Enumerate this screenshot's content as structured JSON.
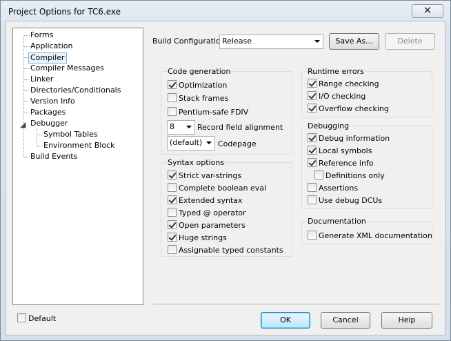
{
  "window": {
    "title": "Project Options for TC6.exe",
    "close_glyph": "✕"
  },
  "tree": {
    "items": [
      {
        "label": "Forms"
      },
      {
        "label": "Application"
      },
      {
        "label": "Compiler",
        "selected": true
      },
      {
        "label": "Compiler Messages"
      },
      {
        "label": "Linker"
      },
      {
        "label": "Directories/Conditionals"
      },
      {
        "label": "Version Info"
      },
      {
        "label": "Packages"
      },
      {
        "label": "Debugger",
        "expanded": true
      },
      {
        "label": "Symbol Tables"
      },
      {
        "label": "Environment Block"
      },
      {
        "label": "Build Events"
      }
    ],
    "expander_glyph": "◢"
  },
  "build_config": {
    "label": "Build Configuration",
    "value": "Release",
    "save_as_label": "Save As...",
    "delete_label": "Delete"
  },
  "code_generation": {
    "title": "Code generation",
    "optimization": {
      "label": "Optimization",
      "checked": true
    },
    "stack_frames": {
      "label": "Stack frames",
      "checked": false
    },
    "pentium_fdiv": {
      "label": "Pentium-safe FDIV",
      "checked": false
    },
    "record_alignment": {
      "value": "8",
      "label": "Record field alignment"
    },
    "codepage": {
      "value": "(default)",
      "label": "Codepage"
    }
  },
  "syntax_options": {
    "title": "Syntax options",
    "items": [
      {
        "label": "Strict var-strings",
        "checked": true
      },
      {
        "label": "Complete boolean eval",
        "checked": false
      },
      {
        "label": "Extended syntax",
        "checked": true
      },
      {
        "label": "Typed @ operator",
        "checked": false
      },
      {
        "label": "Open parameters",
        "checked": true
      },
      {
        "label": "Huge strings",
        "checked": true
      },
      {
        "label": "Assignable typed constants",
        "checked": false
      }
    ]
  },
  "runtime_errors": {
    "title": "Runtime errors",
    "items": [
      {
        "label": "Range checking",
        "checked": true
      },
      {
        "label": "I/O checking",
        "checked": true
      },
      {
        "label": "Overflow checking",
        "checked": true
      }
    ]
  },
  "debugging": {
    "title": "Debugging",
    "items": [
      {
        "label": "Debug information",
        "checked": true
      },
      {
        "label": "Local symbols",
        "checked": true
      },
      {
        "label": "Reference info",
        "checked": true
      },
      {
        "label": "Definitions only",
        "checked": false
      },
      {
        "label": "Assertions",
        "checked": false
      },
      {
        "label": "Use debug DCUs",
        "checked": false
      }
    ]
  },
  "documentation": {
    "title": "Documentation",
    "generate_xml": {
      "label": "Generate XML documentation",
      "checked": false
    }
  },
  "footer": {
    "default_label": "Default",
    "default_checked": false,
    "ok_label": "OK",
    "cancel_label": "Cancel",
    "help_label": "Help"
  }
}
